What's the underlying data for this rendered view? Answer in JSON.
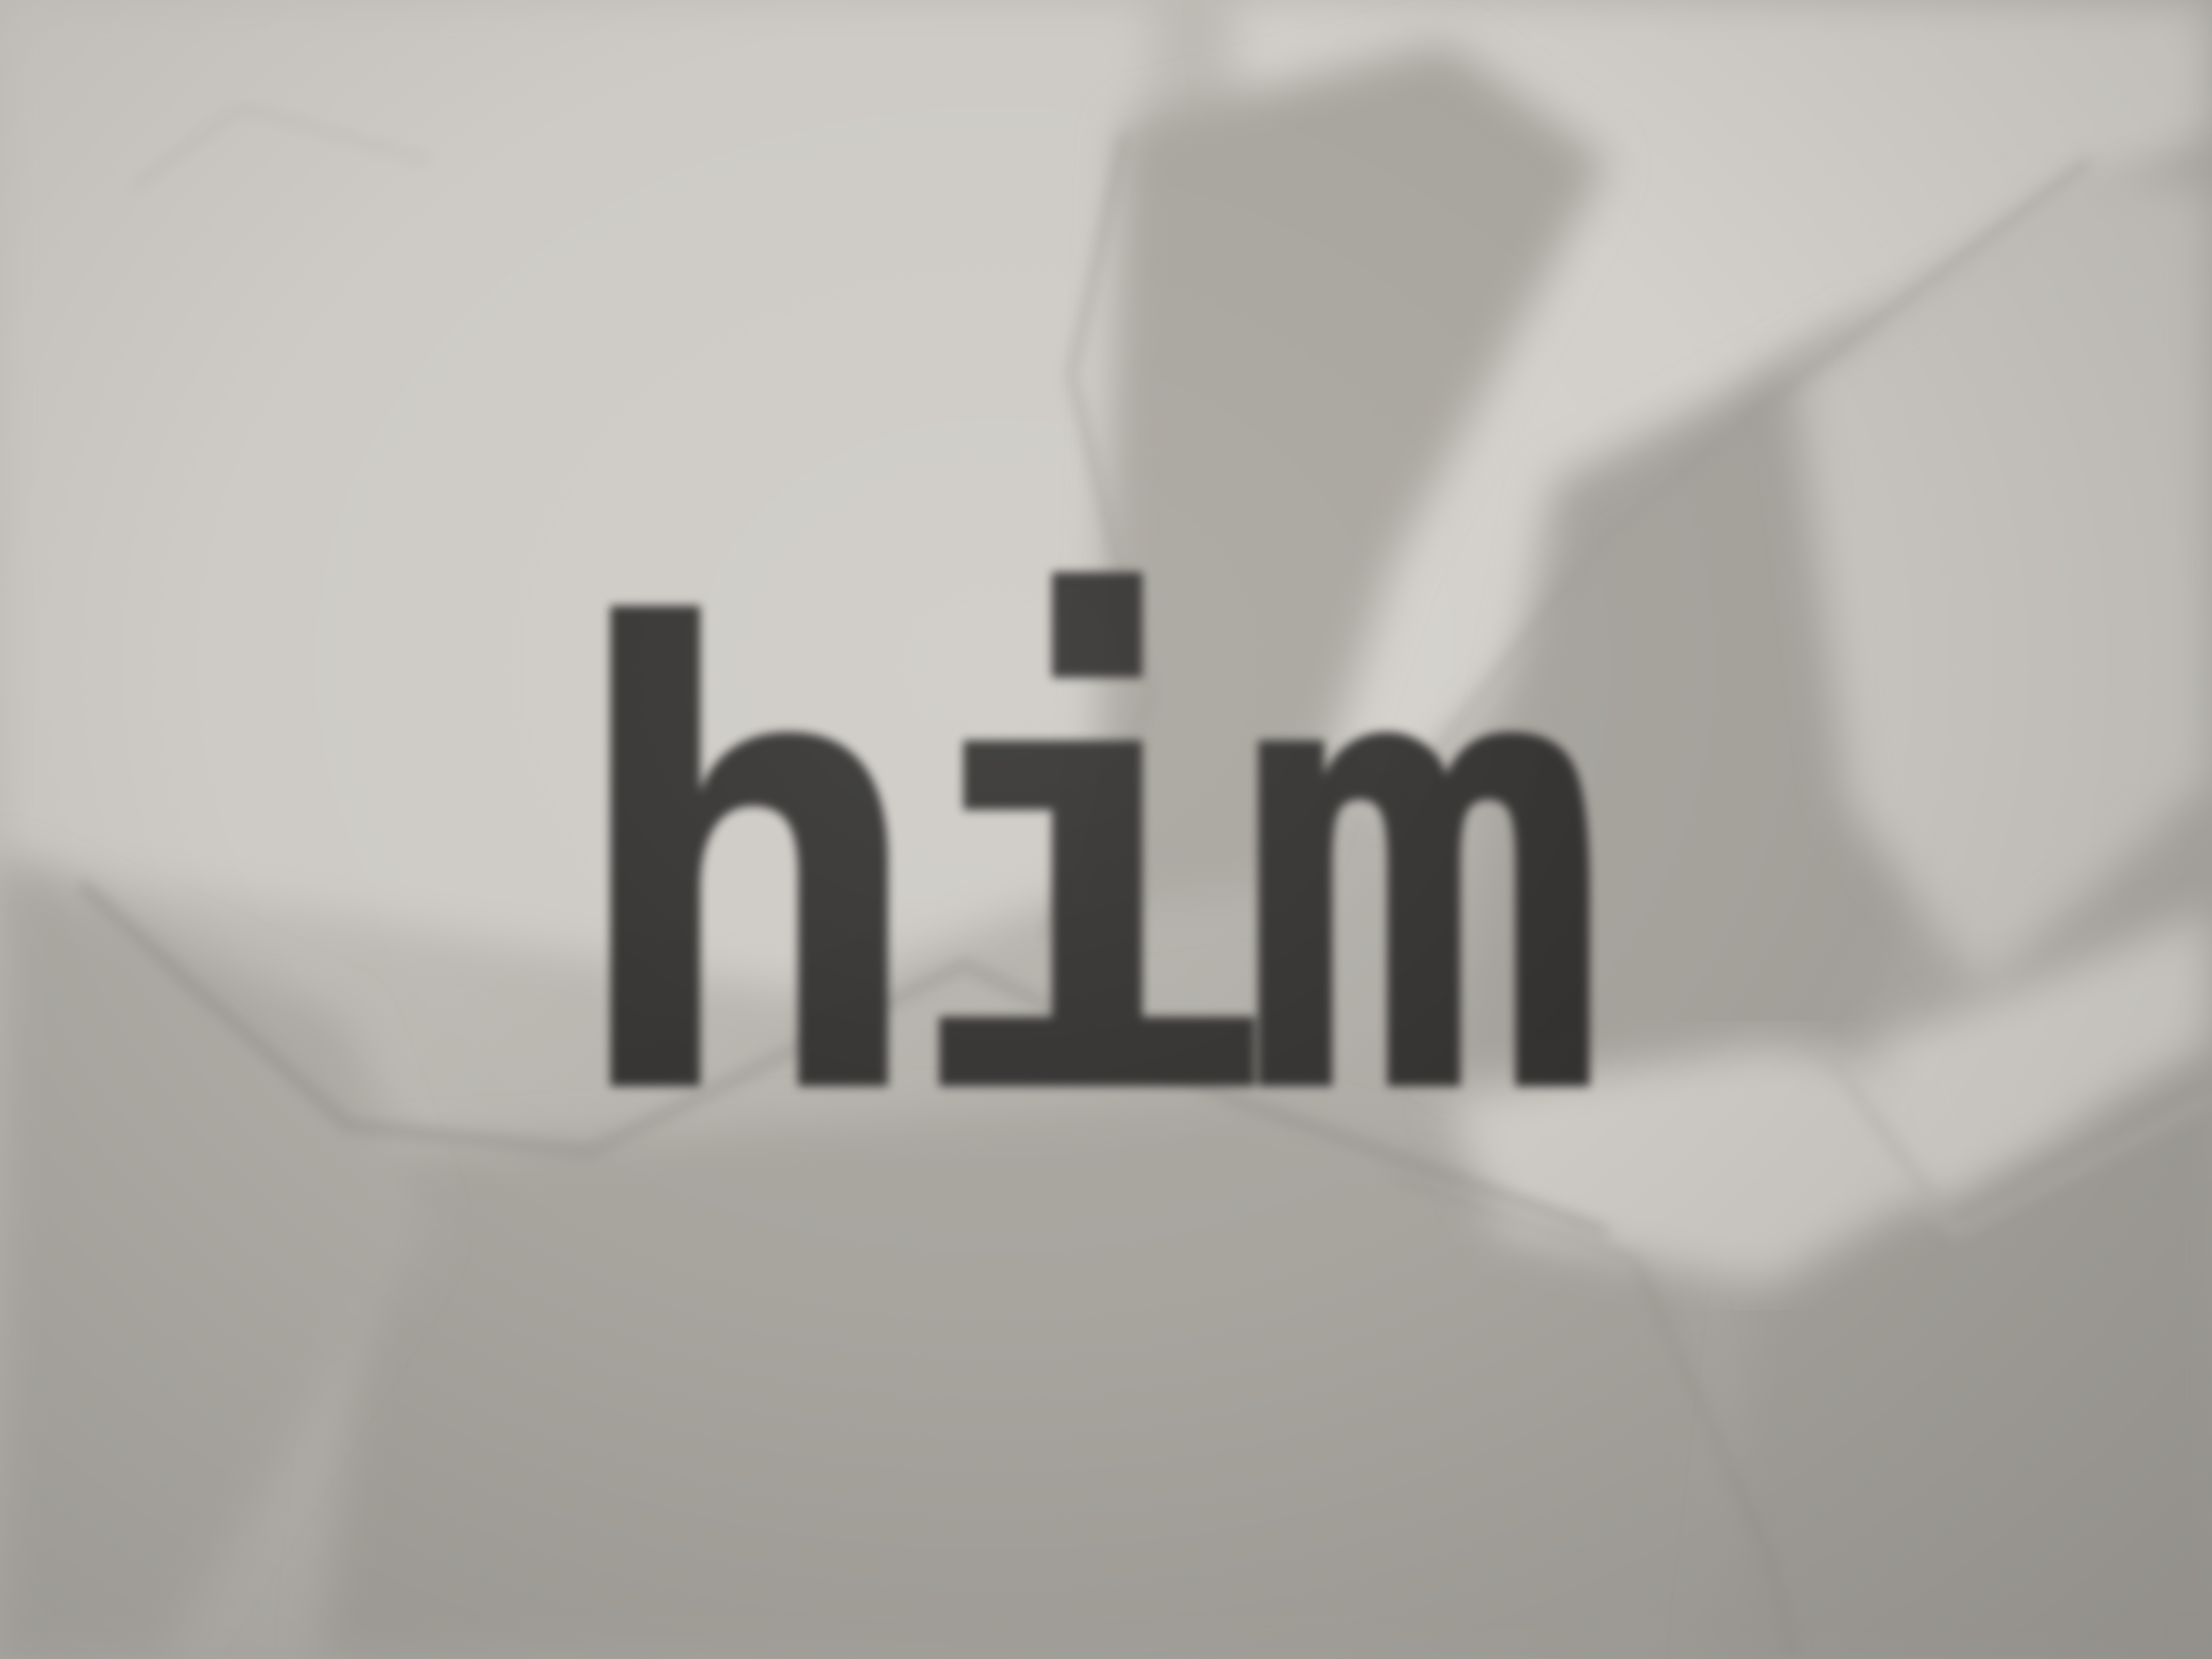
{
  "photo": {
    "printed_word": "him",
    "paper_color": "#c3c0bb",
    "ink_color": "#2d2c2b",
    "shadow_color": "#9e9b95"
  }
}
